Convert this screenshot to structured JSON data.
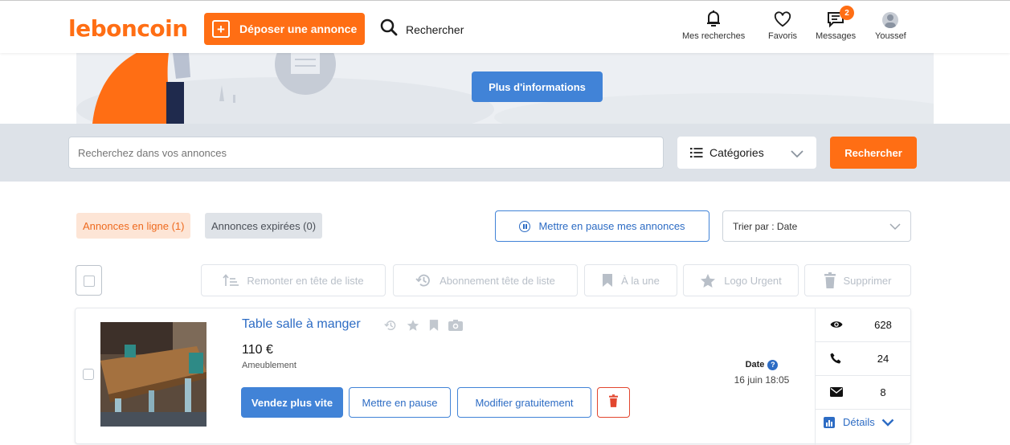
{
  "header": {
    "logo": "leboncoin",
    "post_ad_label": "Déposer une annonce",
    "search_label": "Rechercher",
    "nav": {
      "searches": "Mes recherches",
      "favorites": "Favoris",
      "messages": "Messages",
      "messages_badge": "2",
      "user": "Youssef"
    }
  },
  "banner": {
    "info_button": "Plus d'informations"
  },
  "search_bar": {
    "placeholder": "Recherchez dans vos annonces",
    "category_label": "Catégories",
    "search_button": "Rechercher"
  },
  "tabs": {
    "online": "Annonces en ligne (1)",
    "expired": "Annonces expirées (0)"
  },
  "pause_all_label": "Mettre en pause mes annonces",
  "sort_label": "Trier par : Date",
  "bulk_actions": {
    "bump": "Remonter en tête de liste",
    "subscription": "Abonnement tête de liste",
    "featured": "À la une",
    "urgent": "Logo Urgent",
    "delete": "Supprimer"
  },
  "ad": {
    "title": "Table salle à manger",
    "price": "110 €",
    "category": "Ameublement",
    "sell_faster": "Vendez plus vite",
    "pause": "Mettre en pause",
    "edit": "Modifier gratuitement",
    "date_label": "Date",
    "date_value": "16 juin 18:05",
    "views": "628",
    "calls": "24",
    "messages": "8",
    "details": "Détails"
  },
  "colors": {
    "brand": "#ff6e14",
    "primary": "#4183d7",
    "danger": "#e2462f"
  }
}
